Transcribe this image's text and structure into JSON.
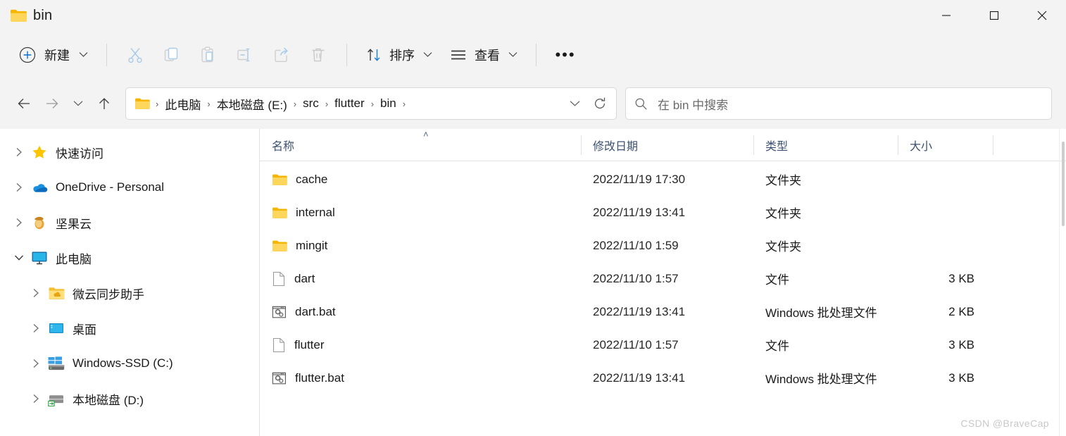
{
  "window": {
    "title": "bin",
    "title_icon": "folder-icon",
    "controls": {
      "minimize": "—",
      "maximize": "☐",
      "close": "✕"
    }
  },
  "toolbar": {
    "new_label": "新建",
    "new_icon": "plus-circle-icon",
    "cut_icon": "scissors-icon",
    "copy_icon": "copy-icon",
    "paste_icon": "paste-icon",
    "rename_icon": "rename-icon",
    "share_icon": "share-icon",
    "delete_icon": "trash-icon",
    "sort_label": "排序",
    "sort_icon": "sort-arrows-icon",
    "view_label": "查看",
    "view_icon": "list-lines-icon",
    "more_label": "•••"
  },
  "address": {
    "back_icon": "arrow-left-icon",
    "forward_icon": "arrow-right-icon",
    "recent_icon": "chevron-down-icon",
    "up_icon": "arrow-up-icon",
    "path_icon": "folder-icon",
    "crumbs": [
      "此电脑",
      "本地磁盘 (E:)",
      "src",
      "flutter",
      "bin"
    ],
    "separator": "›",
    "dropdown_icon": "chevron-down-icon",
    "refresh_icon": "refresh-icon"
  },
  "search": {
    "icon": "search-icon",
    "placeholder": "在 bin 中搜索",
    "value": ""
  },
  "sidebar": {
    "items": [
      {
        "label": "快速访问",
        "icon": "star-icon",
        "expander": "chevron-right",
        "indent": false
      },
      {
        "label": "OneDrive - Personal",
        "icon": "onedrive-cloud-icon",
        "expander": "chevron-right",
        "indent": false
      },
      {
        "label": "坚果云",
        "icon": "nutstore-acorn-icon",
        "expander": "chevron-right",
        "indent": false
      },
      {
        "label": "此电脑",
        "icon": "this-pc-monitor-icon",
        "expander": "chevron-down",
        "indent": false
      },
      {
        "label": "微云同步助手",
        "icon": "weiyun-folder-icon",
        "expander": "chevron-right",
        "indent": true
      },
      {
        "label": "桌面",
        "icon": "desktop-icon",
        "expander": "chevron-right",
        "indent": true
      },
      {
        "label": "Windows-SSD (C:)",
        "icon": "windows-drive-icon",
        "expander": "chevron-right",
        "indent": true
      },
      {
        "label": "本地磁盘 (D:)",
        "icon": "hard-drive-icon",
        "expander": "chevron-right",
        "indent": true
      }
    ]
  },
  "filelist": {
    "columns": {
      "name": "名称",
      "date": "修改日期",
      "type": "类型",
      "size": "大小"
    },
    "sort_indicator": "˄",
    "rows": [
      {
        "name": "cache",
        "date": "2022/11/19 17:30",
        "type": "文件夹",
        "size": "",
        "icon": "folder-icon"
      },
      {
        "name": "internal",
        "date": "2022/11/19 13:41",
        "type": "文件夹",
        "size": "",
        "icon": "folder-icon"
      },
      {
        "name": "mingit",
        "date": "2022/11/10 1:59",
        "type": "文件夹",
        "size": "",
        "icon": "folder-icon"
      },
      {
        "name": "dart",
        "date": "2022/11/10 1:57",
        "type": "文件",
        "size": "3 KB",
        "icon": "file-icon"
      },
      {
        "name": "dart.bat",
        "date": "2022/11/19 13:41",
        "type": "Windows 批处理文件",
        "size": "2 KB",
        "icon": "bat-file-icon"
      },
      {
        "name": "flutter",
        "date": "2022/11/10 1:57",
        "type": "文件",
        "size": "3 KB",
        "icon": "file-icon"
      },
      {
        "name": "flutter.bat",
        "date": "2022/11/19 13:41",
        "type": "Windows 批处理文件",
        "size": "3 KB",
        "icon": "bat-file-icon"
      }
    ]
  },
  "watermark": "CSDN @BraveCap",
  "colors": {
    "chrome": "#f3f3f3",
    "accent": "#0078d4",
    "folder": "#ffc846",
    "header_text": "#3c5170",
    "watermark": "#c8c8c8"
  }
}
